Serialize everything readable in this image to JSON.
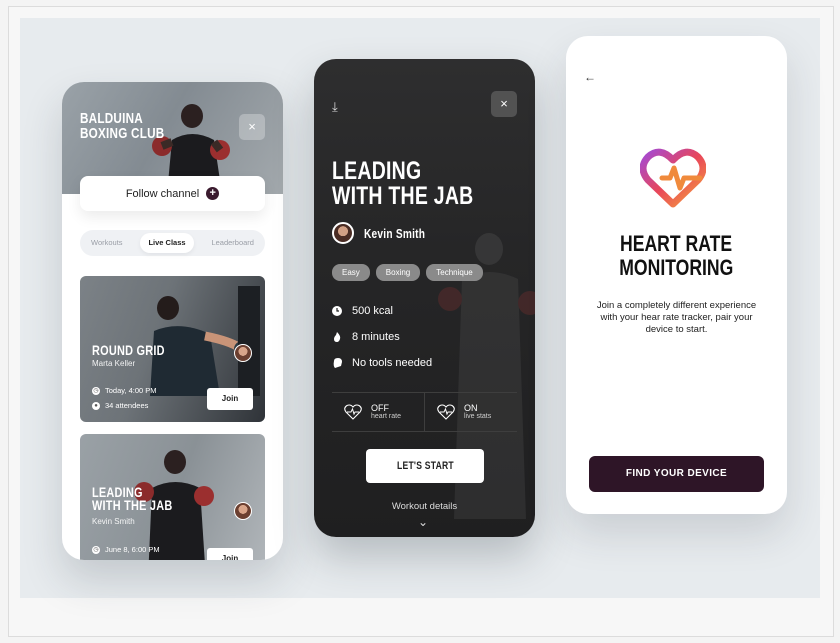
{
  "phone1": {
    "title_line1": "BALDUINA",
    "title_line2": "BOXING CLUB",
    "close_icon": "×",
    "follow_label": "Follow channel",
    "follow_icon": "+",
    "tabs": [
      {
        "label": "Workouts",
        "active": false
      },
      {
        "label": "Live Class",
        "active": true
      },
      {
        "label": "Leaderboard",
        "active": false
      }
    ],
    "cards": [
      {
        "title_line1": "ROUND GRID",
        "title_line2": "",
        "coach": "Marta Keller",
        "time": "Today, 4:00 PM",
        "attendees": "34 attendees",
        "join_label": "Join"
      },
      {
        "title_line1": "LEADING",
        "title_line2": "WITH THE JAB",
        "coach": "Kevin Smith",
        "time": "June 8, 6:00 PM",
        "attendees": "",
        "join_label": "Join"
      }
    ]
  },
  "phone2": {
    "download_icon": "⤓",
    "close_icon": "×",
    "title_line1": "LEADING",
    "title_line2": "WITH THE JAB",
    "author": "Kevin Smith",
    "tags": [
      "Easy",
      "Boxing",
      "Technique"
    ],
    "stats": [
      {
        "icon": "clock-icon",
        "label": "500 kcal"
      },
      {
        "icon": "flame-icon",
        "label": "8 minutes"
      },
      {
        "icon": "glove-icon",
        "label": "No tools needed"
      }
    ],
    "toggles": [
      {
        "state": "OFF",
        "label": "heart rate"
      },
      {
        "state": "ON",
        "label": "live stats"
      }
    ],
    "start_label": "LET'S START",
    "details_label": "Workout details",
    "chevron": "⌄"
  },
  "phone3": {
    "back_icon": "←",
    "title_line1": "HEART RATE",
    "title_line2": "MONITORING",
    "body": "Join a completely different experience with your hear rate tracker, pair your device to start.",
    "find_label": "FIND YOUR DEVICE"
  }
}
